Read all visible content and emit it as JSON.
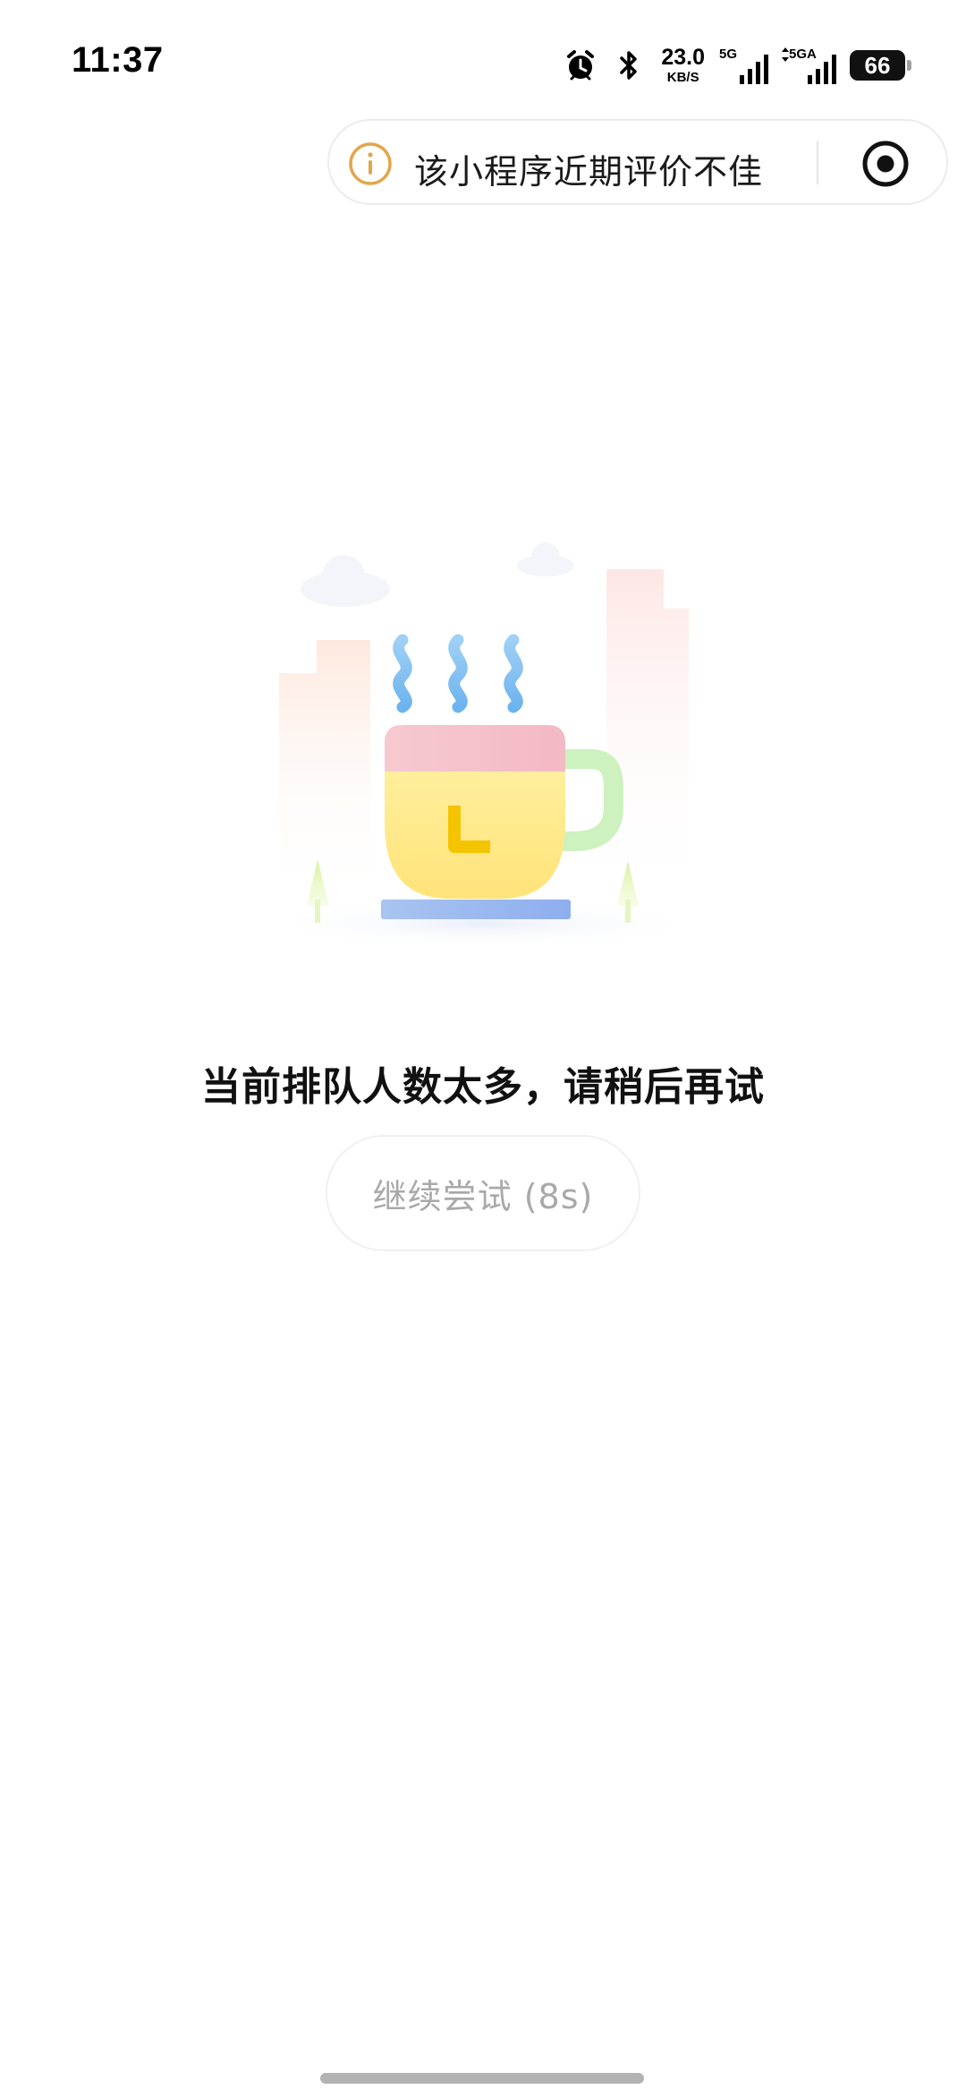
{
  "status_bar": {
    "time": "11:37",
    "net_speed_value": "23.0",
    "net_speed_unit": "KB/S",
    "signal1_label": "5G",
    "signal2_label": "5GA",
    "battery": "66",
    "icons": [
      "alarm-clock-icon",
      "bluetooth-icon",
      "signal-bars-icon",
      "battery-icon"
    ]
  },
  "warning": {
    "text": "该小程序近期评价不佳",
    "icon": "info-icon",
    "action_icon": "target-icon",
    "accent_color": "#e3a64a"
  },
  "main": {
    "illustration": "coffee-cup-illustration",
    "message": "当前排队人数太多，请稍后再试",
    "retry_label": "继续尝试 (8s)"
  }
}
